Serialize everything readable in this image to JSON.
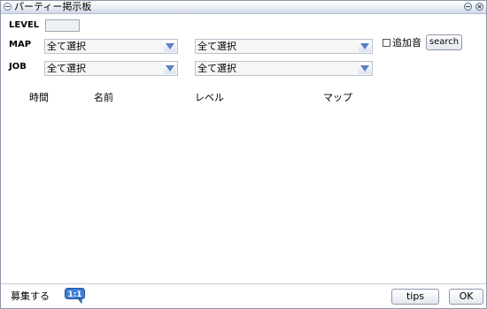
{
  "window": {
    "title": "パーティー掲示板"
  },
  "filters": {
    "level_label": "LEVEL",
    "level_value": "",
    "map_label": "MAP",
    "map_select_1": "全て選択",
    "map_select_2": "全て選択",
    "job_label": "JOB",
    "job_select_1": "全て選択",
    "job_select_2": "全て選択",
    "additional_sound_label": "追加音",
    "additional_sound_checked": false,
    "search_button": "search"
  },
  "table": {
    "columns": [
      "時間",
      "名前",
      "レベル",
      "マップ"
    ],
    "rows": []
  },
  "footer": {
    "recruit_label": "募集する",
    "recruit_icon_text": "1:1",
    "tips_button": "tips",
    "ok_button": "OK"
  }
}
